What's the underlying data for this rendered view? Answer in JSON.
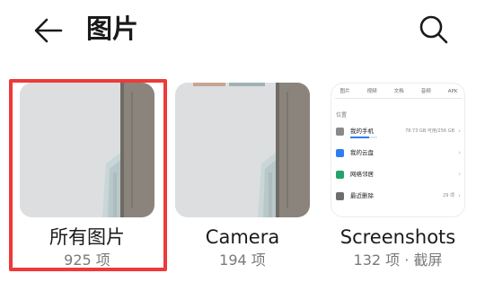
{
  "header": {
    "title": "图片",
    "back_icon": "arrow-left-icon",
    "search_icon": "search-icon"
  },
  "albums": [
    {
      "name": "所有图片",
      "count": "925 项",
      "thumbnail": "wall-photo"
    },
    {
      "name": "Camera",
      "count": "194 项",
      "thumbnail": "wall-photo"
    },
    {
      "name": "Screenshots",
      "count": "132 项",
      "separator": "·",
      "tag": "截屏",
      "thumbnail": "files-app-screenshot"
    }
  ],
  "screenshot_preview": {
    "tabs": [
      "图片",
      "视频",
      "文档",
      "音频",
      "APK"
    ],
    "section": "位置",
    "rows": [
      {
        "label": "我的手机",
        "value": "78.73 GB 可用/256 GB",
        "icon": "phone-icon",
        "icon_color": "#8a8a8a",
        "progress": 0.69
      },
      {
        "label": "我的云盘",
        "value": "",
        "icon": "cloud-icon",
        "icon_color": "#2f7ef0"
      },
      {
        "label": "网络邻居",
        "value": "",
        "icon": "network-icon",
        "icon_color": "#23a36b"
      },
      {
        "label": "最近删除",
        "value": "29 项",
        "icon": "trash-icon",
        "icon_color": "#6e6e6e"
      }
    ]
  },
  "colors": {
    "selection_border": "#ee3a3a",
    "wall": "#d8dadb",
    "pillar": "#8a847c",
    "text_primary": "#1a1a1a",
    "text_secondary": "#7a7a7a"
  }
}
